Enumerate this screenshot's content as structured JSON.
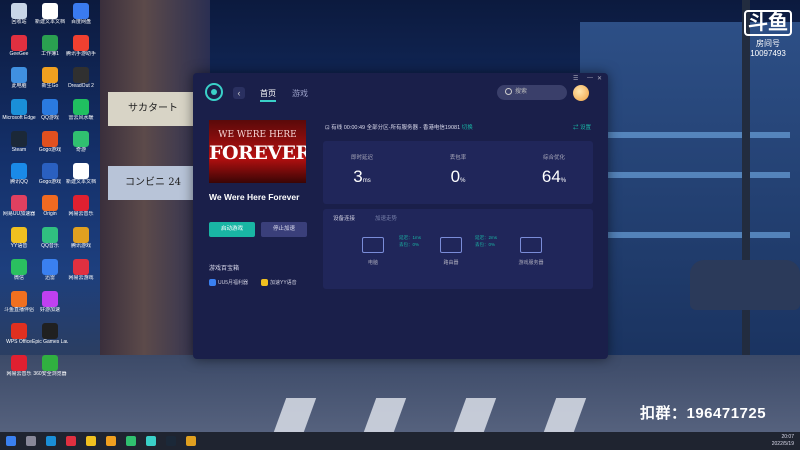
{
  "watermark": {
    "logo": "斗鱼",
    "room_label": "房间号",
    "room_number": "10097493",
    "group_text": "扣群：196471725"
  },
  "desktop_icons": [
    {
      "label": "回收站",
      "color": "#c8d6e8"
    },
    {
      "label": "新建文本文档",
      "color": "#ffffff"
    },
    {
      "label": "百度网盘",
      "color": "#3a7bf0"
    },
    {
      "label": "GeeGee",
      "color": "#e03040"
    },
    {
      "label": "工作簿1",
      "color": "#2aa050"
    },
    {
      "label": "腾讯手游助手",
      "color": "#f04030"
    },
    {
      "label": "此电脑",
      "color": "#4090e0"
    },
    {
      "label": "新生Go",
      "color": "#f0a020"
    },
    {
      "label": "DreadOut 2",
      "color": "#303030"
    },
    {
      "label": "Microsoft Edge",
      "color": "#1a8fd8"
    },
    {
      "label": "QQ游戏",
      "color": "#2a7ae0"
    },
    {
      "label": "雷云风水暖",
      "color": "#20c060"
    },
    {
      "label": "Steam",
      "color": "#1b2838"
    },
    {
      "label": "Gogo游戏",
      "color": "#e05020"
    },
    {
      "label": "奇游",
      "color": "#30c070"
    },
    {
      "label": "腾讯QQ",
      "color": "#1a8ae8"
    },
    {
      "label": "Gogo游戏",
      "color": "#2a60c0"
    },
    {
      "label": "新建文本文档",
      "color": "#ffffff"
    },
    {
      "label": "网易UU加速器",
      "color": "#e04060"
    },
    {
      "label": "Origin",
      "color": "#f06a20"
    },
    {
      "label": "网易云音乐",
      "color": "#e02030"
    },
    {
      "label": "YY语音",
      "color": "#f0c020"
    },
    {
      "label": "QQ音乐",
      "color": "#30c080"
    },
    {
      "label": "腾讯游戏",
      "color": "#e0a020"
    },
    {
      "label": "微信",
      "color": "#2ac060"
    },
    {
      "label": "迅雷",
      "color": "#3a80f0"
    },
    {
      "label": "网易云游戏",
      "color": "#e03040"
    },
    {
      "label": "斗鱼直播伴侣",
      "color": "#f07020"
    },
    {
      "label": "好游加速",
      "color": "#c040f0"
    },
    {
      "label": "WPS Office",
      "color": "#e03020"
    },
    {
      "label": "Epic Games Launcher",
      "color": "#202020"
    },
    {
      "label": "网易云音乐",
      "color": "#e02030"
    },
    {
      "label": "360安全浏览器",
      "color": "#30b040"
    }
  ],
  "app": {
    "tabs": [
      {
        "label": "首页",
        "active": true
      },
      {
        "label": "游戏",
        "active": false
      }
    ],
    "search_placeholder": "搜索",
    "game": {
      "cover_line1": "WE WERE HERE",
      "cover_line2": "FOREVER",
      "name": "We Were Here Forever",
      "start_label": "启动游戏",
      "stop_label": "停止加速"
    },
    "toolbox": {
      "title": "游戏百宝箱",
      "items": [
        {
          "label": "UU5月福利器",
          "color": "#3a80f0"
        },
        {
          "label": "加速YY语音",
          "color": "#f0c020"
        }
      ]
    },
    "status": {
      "prefix": "有线",
      "time": "00:00:49",
      "route": "全部分区-所有服务器 - 香港电信19081",
      "switch_label": "切换",
      "settings_label": "设置"
    },
    "stats": [
      {
        "label": "即时延迟",
        "value": "3",
        "unit": "ms"
      },
      {
        "label": "丢包率",
        "value": "0",
        "unit": "%"
      },
      {
        "label": "综合优化",
        "value": "64",
        "unit": "%"
      }
    ],
    "route_panel": {
      "tab_active": "设备连接",
      "tab_inactive": "加速走势",
      "devices": [
        {
          "label": "电脑"
        },
        {
          "label": "路由器"
        },
        {
          "label": "游戏服务器"
        }
      ],
      "links": [
        {
          "latency": "延迟：1ms",
          "loss": "丢包：0%"
        },
        {
          "latency": "延迟：2ms",
          "loss": "丢包：0%"
        }
      ]
    }
  },
  "taskbar": {
    "time": "20:07",
    "date": "2022/5/19"
  }
}
